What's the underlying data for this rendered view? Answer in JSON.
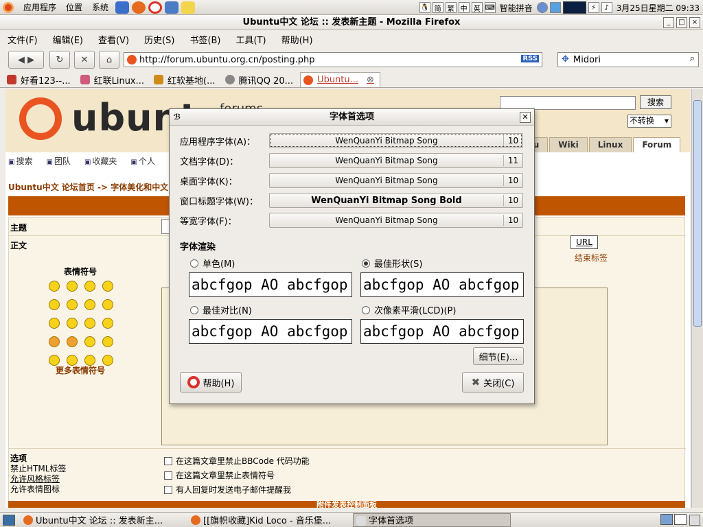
{
  "panel": {
    "menus": [
      "应用程序",
      "位置",
      "系统"
    ],
    "tray": {
      "input_method": "智能拼音",
      "ime_keys": [
        "简",
        "繁",
        "中",
        "英"
      ],
      "datetime": "3月25日星期二 09:33"
    }
  },
  "window": {
    "title": "Ubuntu中文 论坛 :: 发表新主题 - Mozilla Firefox",
    "buttons": [
      "_",
      "□",
      "×"
    ]
  },
  "menubar": [
    "文件(F)",
    "编辑(E)",
    "查看(V)",
    "历史(S)",
    "书签(B)",
    "工具(T)",
    "帮助(H)"
  ],
  "navbar": {
    "url": "http://forum.ubuntu.org.cn/posting.php",
    "rss": "RSS",
    "search_value": "Midori"
  },
  "tabs": [
    {
      "label": "好看123--...",
      "color": "#c0392b"
    },
    {
      "label": "红联Linux...",
      "color": "#d05a7a"
    },
    {
      "label": "红软基地(...",
      "color": "#d08a1a"
    },
    {
      "label": "腾讯QQ 20...",
      "color": "#888888"
    },
    {
      "label": "Ubuntu...",
      "color": "#e95420"
    }
  ],
  "page": {
    "logo_text": "ubunt",
    "forums_text": "forums",
    "search_button": "搜索",
    "convert_select": "不转换",
    "portal_tabs": [
      "tu",
      "Wiki",
      "Linux",
      "Forum"
    ],
    "quicklinks": [
      "搜索",
      "团队",
      "收藏夹",
      "个人"
    ],
    "breadcrumb": "Ubuntu中文 论坛首页 -> 字体美化和中文",
    "labels": {
      "subject": "主题",
      "body": "正文",
      "emoticons": "表情符号",
      "more_emoticons": "更多表情符号",
      "options": "选项",
      "opt_html": "禁止HTML标签",
      "opt_bbcode": "允许风格标签",
      "opt_smilies": "允许表情图标",
      "url": "URL",
      "end_tag": "结束标签"
    },
    "checkboxes": [
      "在这篇文章里禁止BBCode 代码功能",
      "在这篇文章里禁止表情符号",
      "有人回复时发送电子邮件提醒我"
    ],
    "bottom_strip": "附件发表控制面板"
  },
  "dialog": {
    "title": "字体首选项",
    "fonts": [
      {
        "label": "应用程序字体(A)：",
        "name": "WenQuanYi Bitmap Song",
        "size": "10"
      },
      {
        "label": "文档字体(D)：",
        "name": "WenQuanYi Bitmap Song",
        "size": "11"
      },
      {
        "label": "桌面字体(K)：",
        "name": "WenQuanYi Bitmap Song",
        "size": "10"
      },
      {
        "label": "窗口标题字体(W)：",
        "name": "WenQuanYi Bitmap Song Bold",
        "size": "10"
      },
      {
        "label": "等宽字体(F)：",
        "name": "WenQuanYi Bitmap Song",
        "size": "10"
      }
    ],
    "render_title": "字体渲染",
    "render_options": [
      {
        "label": "单色(M)",
        "selected": false
      },
      {
        "label": "最佳形状(S)",
        "selected": true
      },
      {
        "label": "最佳对比(N)",
        "selected": false
      },
      {
        "label": "次像素平滑(LCD)(P)",
        "selected": false
      }
    ],
    "sample_text": "abcfgop AO abcfgop",
    "details_button": "细节(E)...",
    "help_button": "帮助(H)",
    "close_button": "关闭(C)"
  },
  "taskbar": [
    {
      "label": "Ubuntu中文 论坛 :: 发表新主...",
      "active": false
    },
    {
      "label": "[[旗帜收藏]Kid Loco - 音乐堡...",
      "active": false
    },
    {
      "label": "字体首选项",
      "active": true
    }
  ]
}
